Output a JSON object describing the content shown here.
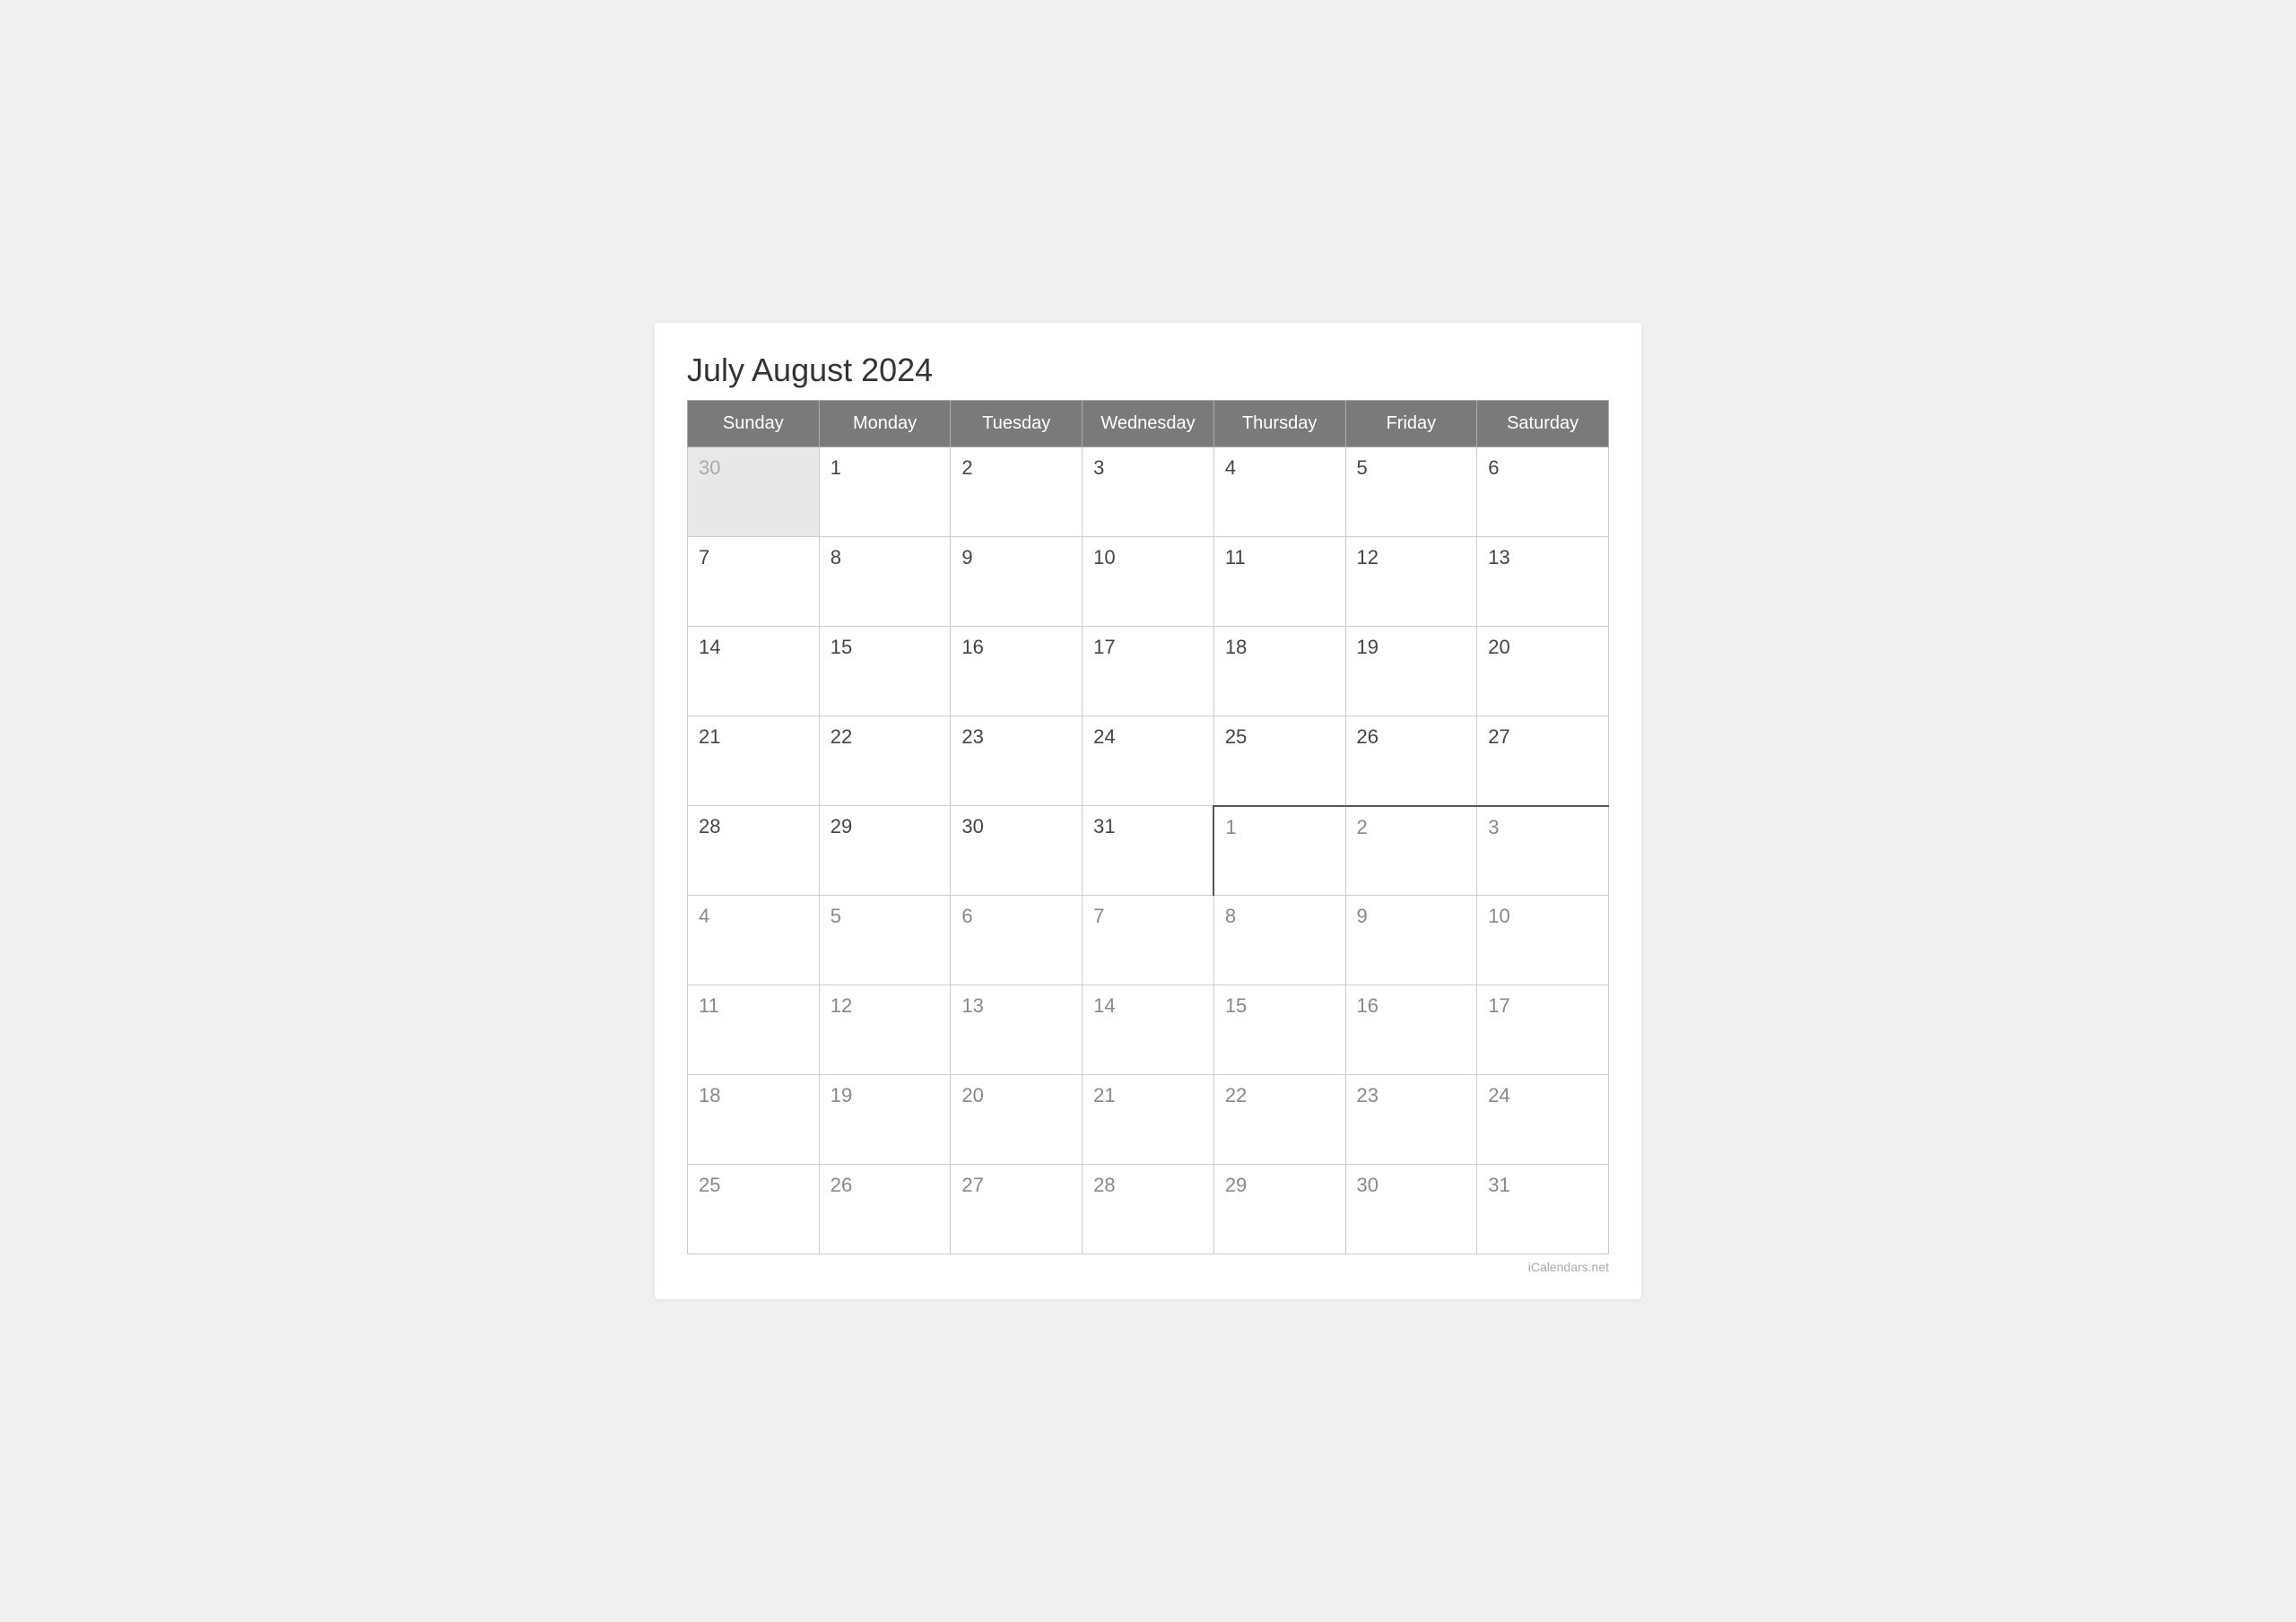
{
  "title": "July August 2024",
  "watermark": "iCalendars.net",
  "headers": [
    "Sunday",
    "Monday",
    "Tuesday",
    "Wednesday",
    "Thursday",
    "Friday",
    "Saturday"
  ],
  "rows": [
    [
      {
        "day": "30",
        "type": "prev-month"
      },
      {
        "day": "1",
        "type": "current"
      },
      {
        "day": "2",
        "type": "current"
      },
      {
        "day": "3",
        "type": "current"
      },
      {
        "day": "4",
        "type": "current"
      },
      {
        "day": "5",
        "type": "current"
      },
      {
        "day": "6",
        "type": "current"
      }
    ],
    [
      {
        "day": "7",
        "type": "current"
      },
      {
        "day": "8",
        "type": "current"
      },
      {
        "day": "9",
        "type": "current"
      },
      {
        "day": "10",
        "type": "current"
      },
      {
        "day": "11",
        "type": "current"
      },
      {
        "day": "12",
        "type": "current"
      },
      {
        "day": "13",
        "type": "current"
      }
    ],
    [
      {
        "day": "14",
        "type": "current"
      },
      {
        "day": "15",
        "type": "current"
      },
      {
        "day": "16",
        "type": "current"
      },
      {
        "day": "17",
        "type": "current"
      },
      {
        "day": "18",
        "type": "current"
      },
      {
        "day": "19",
        "type": "current"
      },
      {
        "day": "20",
        "type": "current"
      }
    ],
    [
      {
        "day": "21",
        "type": "current"
      },
      {
        "day": "22",
        "type": "current"
      },
      {
        "day": "23",
        "type": "current"
      },
      {
        "day": "24",
        "type": "current"
      },
      {
        "day": "25",
        "type": "current"
      },
      {
        "day": "26",
        "type": "current"
      },
      {
        "day": "27",
        "type": "current"
      }
    ],
    [
      {
        "day": "28",
        "type": "current"
      },
      {
        "day": "29",
        "type": "current"
      },
      {
        "day": "30",
        "type": "current"
      },
      {
        "day": "31",
        "type": "current"
      },
      {
        "day": "1",
        "type": "next-month",
        "divider": "left"
      },
      {
        "day": "2",
        "type": "next-month"
      },
      {
        "day": "3",
        "type": "next-month"
      }
    ],
    [
      {
        "day": "4",
        "type": "next-month"
      },
      {
        "day": "5",
        "type": "next-month"
      },
      {
        "day": "6",
        "type": "next-month"
      },
      {
        "day": "7",
        "type": "next-month"
      },
      {
        "day": "8",
        "type": "next-month"
      },
      {
        "day": "9",
        "type": "next-month"
      },
      {
        "day": "10",
        "type": "next-month"
      }
    ],
    [
      {
        "day": "11",
        "type": "next-month"
      },
      {
        "day": "12",
        "type": "next-month"
      },
      {
        "day": "13",
        "type": "next-month"
      },
      {
        "day": "14",
        "type": "next-month"
      },
      {
        "day": "15",
        "type": "next-month"
      },
      {
        "day": "16",
        "type": "next-month"
      },
      {
        "day": "17",
        "type": "next-month"
      }
    ],
    [
      {
        "day": "18",
        "type": "next-month"
      },
      {
        "day": "19",
        "type": "next-month"
      },
      {
        "day": "20",
        "type": "next-month"
      },
      {
        "day": "21",
        "type": "next-month"
      },
      {
        "day": "22",
        "type": "next-month"
      },
      {
        "day": "23",
        "type": "next-month"
      },
      {
        "day": "24",
        "type": "next-month"
      }
    ],
    [
      {
        "day": "25",
        "type": "next-month"
      },
      {
        "day": "26",
        "type": "next-month"
      },
      {
        "day": "27",
        "type": "next-month"
      },
      {
        "day": "28",
        "type": "next-month"
      },
      {
        "day": "29",
        "type": "next-month"
      },
      {
        "day": "30",
        "type": "next-month"
      },
      {
        "day": "31",
        "type": "next-month"
      }
    ]
  ]
}
